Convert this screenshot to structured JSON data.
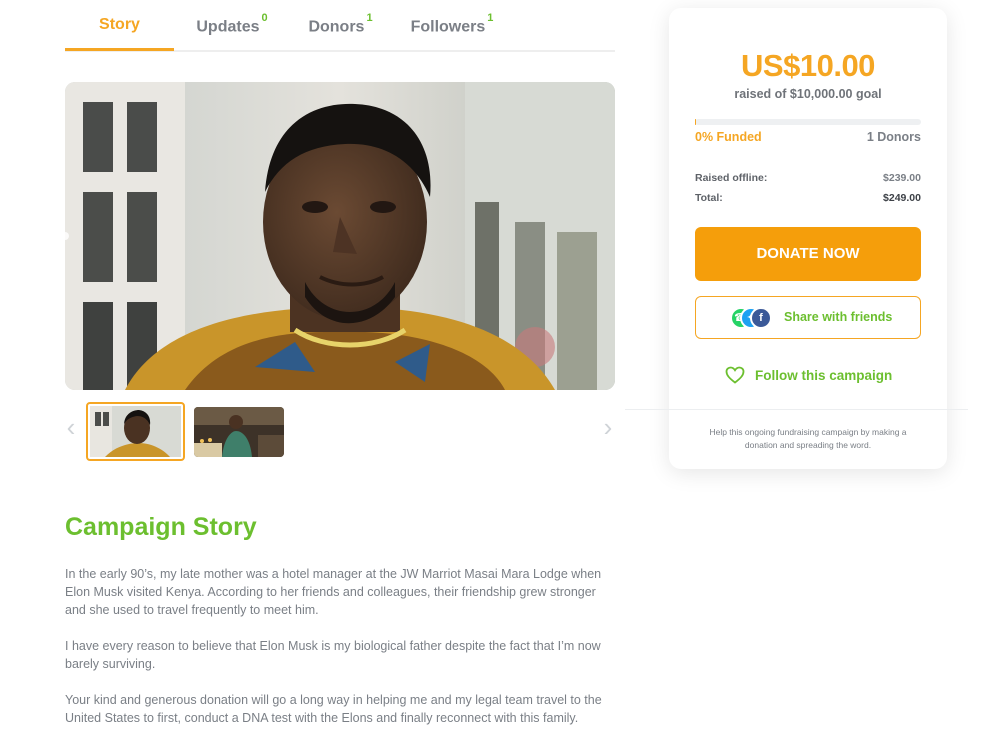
{
  "tabs": [
    {
      "label": "Story",
      "count": ""
    },
    {
      "label": "Updates",
      "count": "0"
    },
    {
      "label": "Donors",
      "count": "1"
    },
    {
      "label": "Followers",
      "count": "1"
    }
  ],
  "gallery": {
    "prev_icon": "chevron-left-icon",
    "next_icon": "chevron-right-icon",
    "thumbnails": [
      "thumbnail-portrait",
      "thumbnail-birthday"
    ]
  },
  "story": {
    "title": "Campaign Story",
    "paragraphs": [
      "In the early 90’s, my late mother was a hotel manager at the JW Marriot Masai Mara Lodge when Elon Musk visited Kenya. According to her friends and colleagues, their friendship grew stronger and she used to travel frequently to meet him.",
      "I have every reason to believe that Elon Musk is my biological father despite the fact that I’m now barely surviving.",
      "Your kind and generous donation will go a long way in helping me and my legal team travel to the United States to first, conduct a DNA test with the Elons and finally reconnect with this family."
    ]
  },
  "campaign": {
    "raised": "US$10.00",
    "goal_text": "raised of $10,000.00 goal",
    "progress_fraction": 0.001,
    "funded": "0% Funded",
    "donors": "1 Donors",
    "offline_label": "Raised offline:",
    "offline_value": "$239.00",
    "total_label": "Total:",
    "total_value": "$249.00",
    "donate_label": "DONATE NOW",
    "share_label": "Share with friends",
    "follow_label": "Follow this campaign",
    "help_text": "Help this ongoing fundraising campaign by making a donation and spreading the word."
  },
  "colors": {
    "accent_orange": "#f5a623",
    "accent_green": "#6cbf2f",
    "whatsapp": "#25d366",
    "twitter": "#1da1f2",
    "facebook": "#3b5998"
  }
}
